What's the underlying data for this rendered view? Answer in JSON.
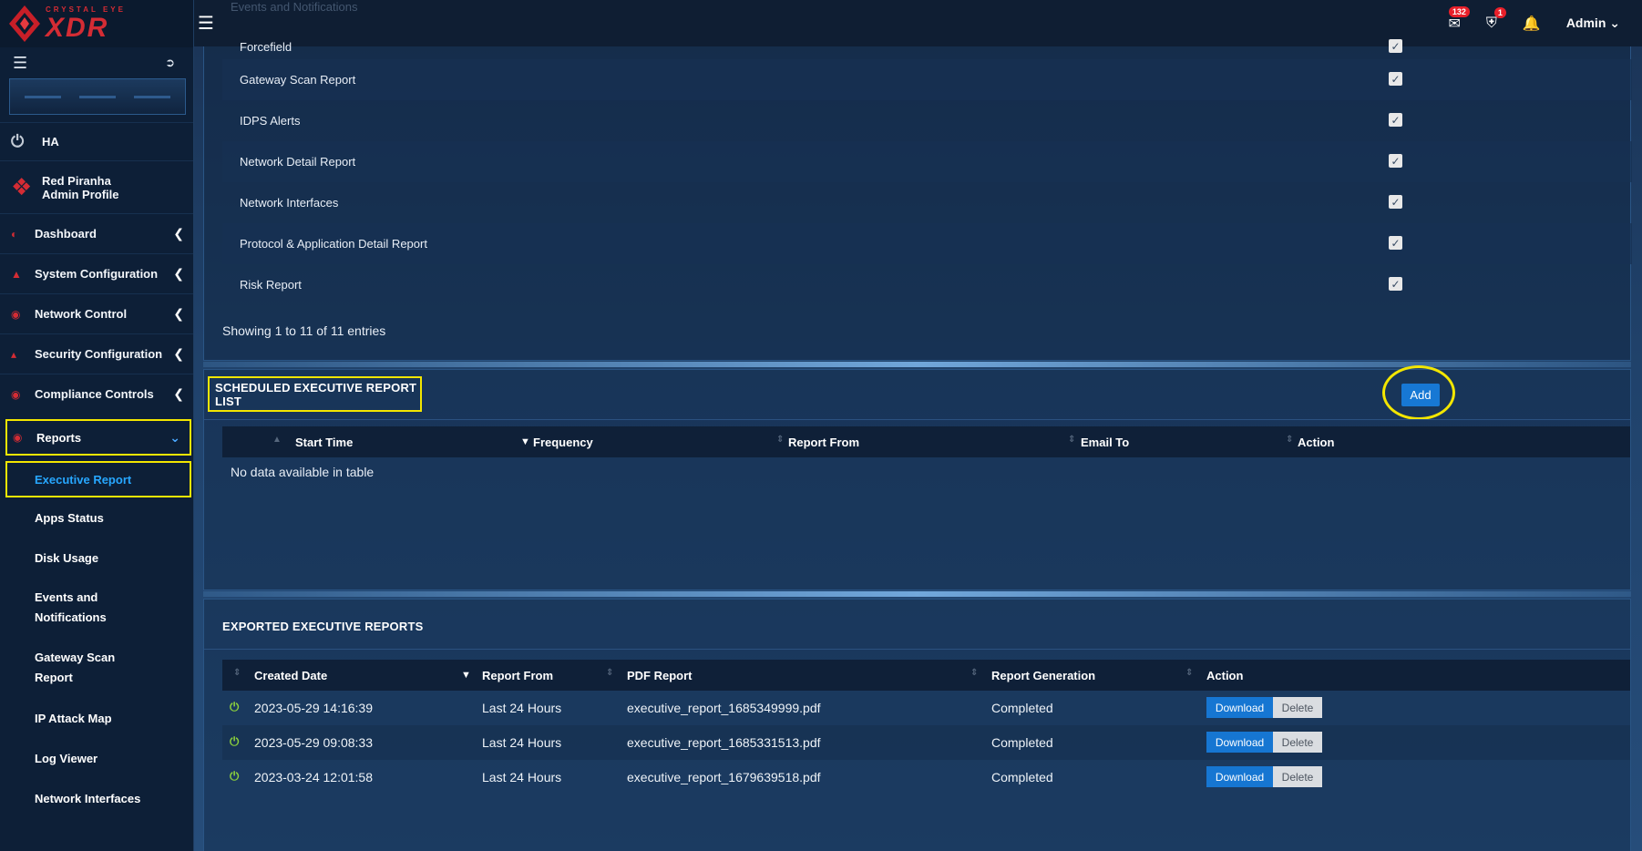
{
  "brand": {
    "small": "CRYSTAL EYE",
    "big": "XDR"
  },
  "topbar": {
    "ghost_text": "Events and Notifications",
    "mail_badge": "132",
    "shield_badge": "1",
    "user_label": "Admin"
  },
  "sidebar": {
    "ha_label": "HA",
    "profile_line1": "Red Piranha",
    "profile_line2": "Admin Profile",
    "nav": [
      {
        "label": "Dashboard"
      },
      {
        "label": "System Configuration"
      },
      {
        "label": "Network Control"
      },
      {
        "label": "Security Configuration"
      },
      {
        "label": "Compliance Controls"
      }
    ],
    "reports_label": "Reports",
    "sub_items": [
      {
        "label": "Executive Report"
      },
      {
        "label": "Apps Status"
      },
      {
        "label": "Disk Usage"
      },
      {
        "label": "Events and Notifications"
      },
      {
        "label": "Gateway Scan Report"
      },
      {
        "label": "IP Attack Map"
      },
      {
        "label": "Log Viewer"
      },
      {
        "label": "Network Interfaces"
      }
    ]
  },
  "report_types": {
    "rows": [
      {
        "label": "Forcefield"
      },
      {
        "label": "Gateway Scan Report"
      },
      {
        "label": "IDPS Alerts"
      },
      {
        "label": "Network Detail Report"
      },
      {
        "label": "Network Interfaces"
      },
      {
        "label": "Protocol & Application Detail Report"
      },
      {
        "label": "Risk Report"
      }
    ],
    "showing": "Showing 1 to 11 of 11 entries"
  },
  "scheduled": {
    "title": "SCHEDULED EXECUTIVE REPORT LIST",
    "add_label": "Add",
    "columns": [
      "Start Time",
      "Frequency",
      "Report From",
      "Email To",
      "Action"
    ],
    "empty_text": "No data available in table"
  },
  "exported": {
    "title": "EXPORTED EXECUTIVE REPORTS",
    "columns": [
      "Created Date",
      "Report From",
      "PDF Report",
      "Report Generation",
      "Action"
    ],
    "rows": [
      {
        "created": "2023-05-29 14:16:39",
        "from": "Last 24 Hours",
        "pdf": "executive_report_1685349999.pdf",
        "status": "Completed"
      },
      {
        "created": "2023-05-29 09:08:33",
        "from": "Last 24 Hours",
        "pdf": "executive_report_1685331513.pdf",
        "status": "Completed"
      },
      {
        "created": "2023-03-24 12:01:58",
        "from": "Last 24 Hours",
        "pdf": "executive_report_1679639518.pdf",
        "status": "Completed"
      }
    ],
    "download_label": "Download",
    "delete_label": "Delete"
  }
}
